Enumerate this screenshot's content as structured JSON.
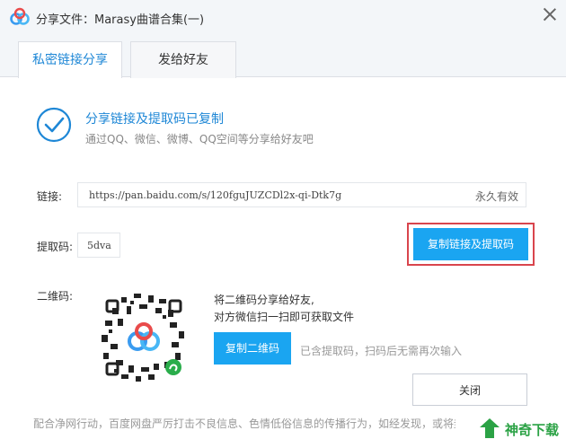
{
  "window": {
    "title": "分享文件：Marasy曲谱合集(一)"
  },
  "tabs": [
    {
      "label": "私密链接分享",
      "active": true
    },
    {
      "label": "发给好友",
      "active": false
    }
  ],
  "success": {
    "title": "分享链接及提取码已复制",
    "subtitle": "通过QQ、微信、微博、QQ空间等分享给好友吧"
  },
  "link": {
    "label": "链接:",
    "url": "https://pan.baidu.com/s/120fguJUZCDl2x-qi-Dtk7g",
    "validity": "永久有效"
  },
  "code": {
    "label": "提取码:",
    "value": "5dva"
  },
  "buttons": {
    "copy_link": "复制链接及提取码",
    "copy_qr": "复制二维码",
    "close": "关闭"
  },
  "qr": {
    "label": "二维码:",
    "desc1": "将二维码分享给好友,",
    "desc2": "对方微信扫一扫即可获取文件",
    "hint": "已含提取码，扫码后无需再次输入"
  },
  "footer": {
    "text": "配合净网行动，百度网盘严厉打击不良信息、色情低俗信息的传播行为，如经发现，或将封号"
  },
  "watermark": {
    "text": "神奇下载"
  },
  "colors": {
    "accent": "#1aa5f1",
    "link_text": "#1e87d6",
    "highlight": "#d9454d"
  }
}
